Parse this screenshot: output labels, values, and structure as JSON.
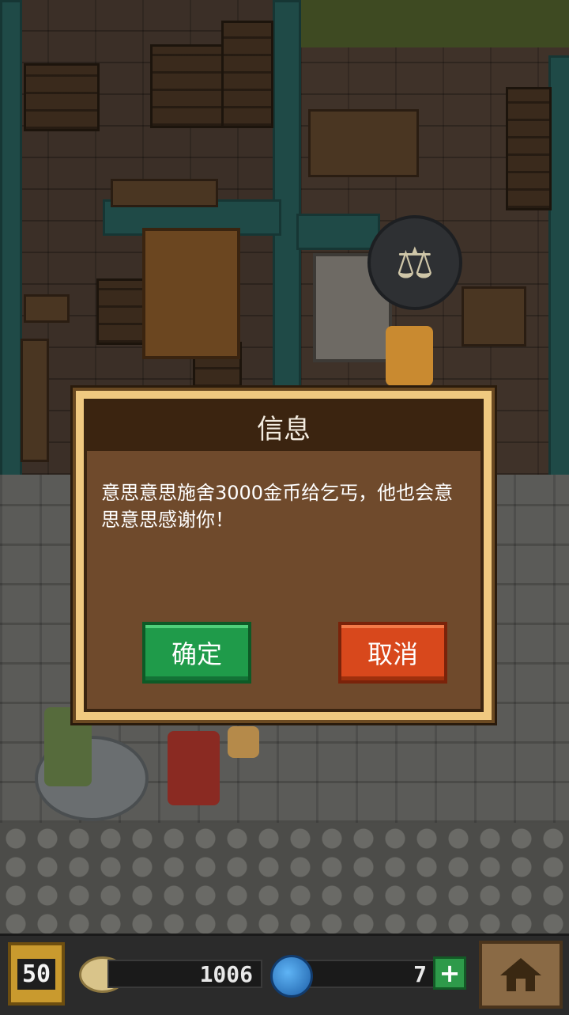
{
  "dialog": {
    "title": "信息",
    "message": "意思意思施舍3000金币给乞丐，他也会意思意思感谢你！",
    "confirm_label": "确定",
    "cancel_label": "取消"
  },
  "hud": {
    "level": "50",
    "gold": "1006",
    "gems": "7",
    "plus_label": "+",
    "icons": {
      "gold": "coin-icon",
      "gems": "gem-icon",
      "home": "home-icon",
      "level": "level-badge-icon"
    }
  },
  "scene": {
    "shop_sign": "scales-icon"
  },
  "colors": {
    "confirm": "#1f9b4a",
    "cancel": "#d8481c",
    "dialog_frame": "#f0c980",
    "dialog_body": "#6f4a2c",
    "dialog_header": "#3b2410"
  }
}
